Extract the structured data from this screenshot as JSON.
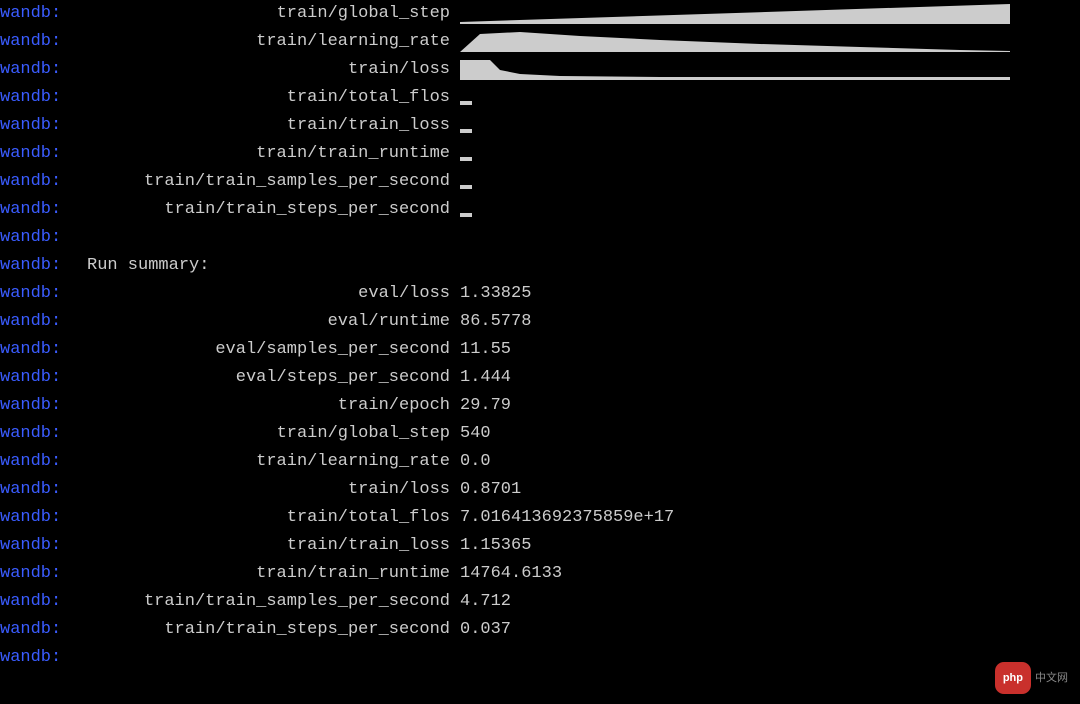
{
  "prefix": "wandb:",
  "history": [
    {
      "name": "train/global_step",
      "type": "spark1"
    },
    {
      "name": "train/learning_rate",
      "type": "spark2"
    },
    {
      "name": "train/loss",
      "type": "spark3"
    },
    {
      "name": "train/total_flos",
      "type": "bar"
    },
    {
      "name": "train/train_loss",
      "type": "bar"
    },
    {
      "name": "train/train_runtime",
      "type": "bar"
    },
    {
      "name": "train/train_samples_per_second",
      "type": "bar"
    },
    {
      "name": "train/train_steps_per_second",
      "type": "bar"
    }
  ],
  "summary_label": "Run summary:",
  "summary": [
    {
      "name": "eval/loss",
      "value": "1.33825"
    },
    {
      "name": "eval/runtime",
      "value": "86.5778"
    },
    {
      "name": "eval/samples_per_second",
      "value": "11.55"
    },
    {
      "name": "eval/steps_per_second",
      "value": "1.444"
    },
    {
      "name": "train/epoch",
      "value": "29.79"
    },
    {
      "name": "train/global_step",
      "value": "540"
    },
    {
      "name": "train/learning_rate",
      "value": "0.0"
    },
    {
      "name": "train/loss",
      "value": "0.8701"
    },
    {
      "name": "train/total_flos",
      "value": "7.016413692375859e+17"
    },
    {
      "name": "train/train_loss",
      "value": "1.15365"
    },
    {
      "name": "train/train_runtime",
      "value": "14764.6133"
    },
    {
      "name": "train/train_samples_per_second",
      "value": "4.712"
    },
    {
      "name": "train/train_steps_per_second",
      "value": "0.037"
    }
  ],
  "watermark": {
    "badge": "php",
    "text": "中文网"
  }
}
